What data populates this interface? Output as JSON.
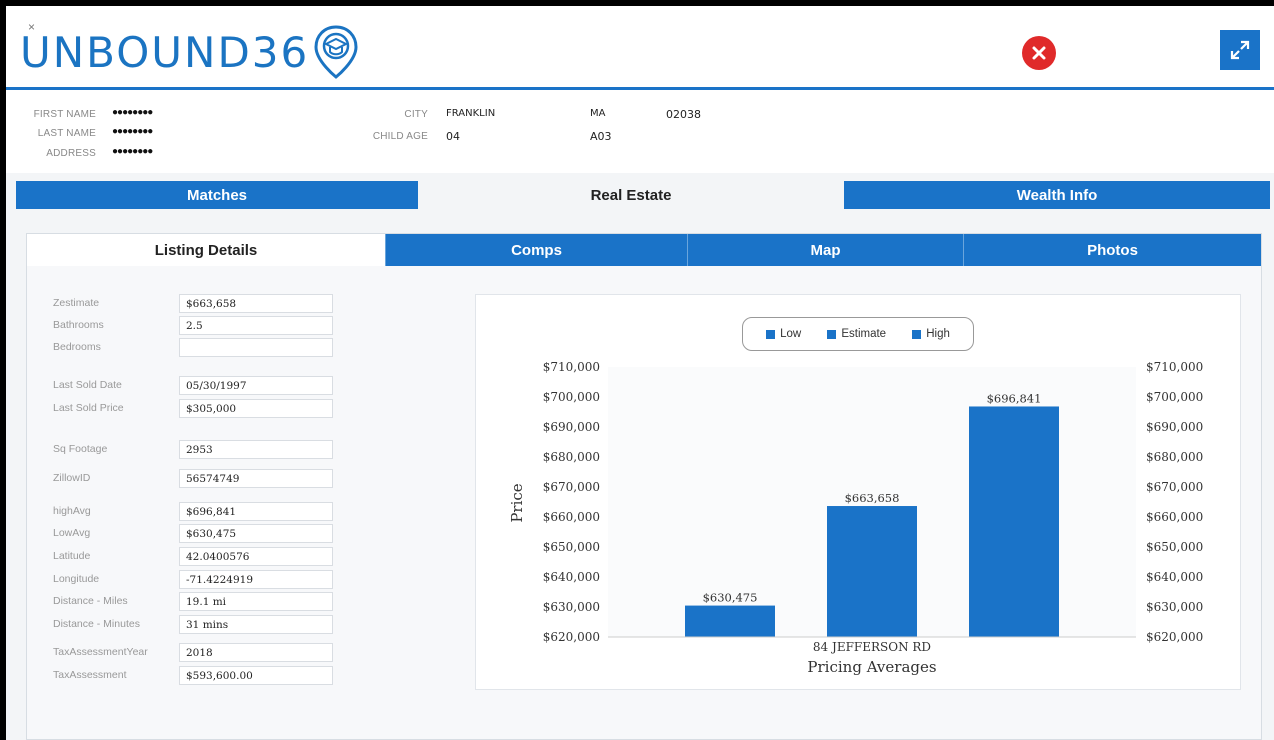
{
  "app": {
    "logo_text": "UNBOUND36",
    "small_close": "×"
  },
  "info": {
    "first_name_label": "FIRST NAME",
    "first_name_value": "●●●●●●●●",
    "last_name_label": "LAST NAME",
    "last_name_value": "●●●●●●●●",
    "address_label": "ADDRESS",
    "address_value": "●●●●●●●●",
    "city_label": "CITY",
    "city_value": "FRANKLIN",
    "state_value": "MA",
    "zip_value": "02038",
    "child_age_label": "CHILD AGE",
    "child_age_value": "04",
    "child_code_value": "A03"
  },
  "main_tabs": [
    {
      "label": "Matches"
    },
    {
      "label": "Real Estate"
    },
    {
      "label": "Wealth Info"
    }
  ],
  "sub_tabs": [
    {
      "label": "Listing Details"
    },
    {
      "label": "Comps"
    },
    {
      "label": "Map"
    },
    {
      "label": "Photos"
    }
  ],
  "fields": [
    {
      "label": "Zestimate",
      "value": "$663,658"
    },
    {
      "label": "Bathrooms",
      "value": "2.5"
    },
    {
      "label": "Bedrooms",
      "value": ""
    },
    {
      "label": "Last Sold Date",
      "value": "05/30/1997"
    },
    {
      "label": "Last Sold Price",
      "value": "$305,000"
    },
    {
      "label": "Sq Footage",
      "value": "2953"
    },
    {
      "label": "ZillowID",
      "value": "56574749"
    },
    {
      "label": "highAvg",
      "value": "$696,841"
    },
    {
      "label": "LowAvg",
      "value": "$630,475"
    },
    {
      "label": "Latitude",
      "value": "42.0400576"
    },
    {
      "label": "Longitude",
      "value": "-71.4224919"
    },
    {
      "label": "Distance - Miles",
      "value": "19.1 mi"
    },
    {
      "label": "Distance - Minutes",
      "value": "31 mins"
    },
    {
      "label": "TaxAssessmentYear",
      "value": "2018"
    },
    {
      "label": "TaxAssessment",
      "value": "$593,600.00"
    }
  ],
  "colors": {
    "accent": "#1a73c8",
    "close": "#e02a2a"
  },
  "icons": {
    "close": "close-circle-icon",
    "expand": "expand-arrows-icon",
    "logo": "graduation-cap-pin-icon"
  },
  "chart_data": {
    "type": "bar",
    "categories": [
      "84 JEFFERSON RD"
    ],
    "series": [
      {
        "name": "Low",
        "values": [
          630475
        ],
        "label": "$630,475"
      },
      {
        "name": "Estimate",
        "values": [
          663658
        ],
        "label": "$663,658"
      },
      {
        "name": "High",
        "values": [
          696841
        ],
        "label": "$696,841"
      }
    ],
    "xlabel": "Pricing Averages",
    "ylabel": "Price",
    "ylim": [
      620000,
      710000
    ],
    "yticks": [
      620000,
      630000,
      640000,
      650000,
      660000,
      670000,
      680000,
      690000,
      700000,
      710000
    ],
    "ytick_labels": [
      "$620,000",
      "$630,000",
      "$640,000",
      "$650,000",
      "$660,000",
      "$670,000",
      "$680,000",
      "$690,000",
      "$700,000",
      "$710,000"
    ],
    "legend": "top-center",
    "secondary_axis": true,
    "grid": false
  }
}
